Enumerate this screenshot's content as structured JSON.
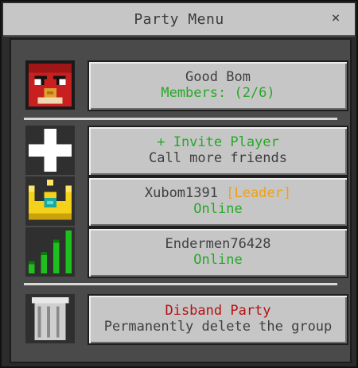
{
  "window": {
    "title": "Party Menu",
    "close_label": "×"
  },
  "party": {
    "name": "Good Bom",
    "members_text": "Members: (2/6)"
  },
  "invite": {
    "title": "+ Invite Player",
    "subtitle": "Call more friends"
  },
  "members": [
    {
      "name": "Xubom1391",
      "tag": "[Leader]",
      "status": "Online",
      "icon": "crown-icon"
    },
    {
      "name": "Endermen76428",
      "tag": "",
      "status": "Online",
      "icon": "signal-icon"
    }
  ],
  "disband": {
    "title": "Disband Party",
    "subtitle": "Permanently delete the group"
  },
  "colors": {
    "green": "#27a827",
    "red": "#b81010",
    "gold": "#f0a018",
    "gray_text": "#3f3f3f"
  }
}
